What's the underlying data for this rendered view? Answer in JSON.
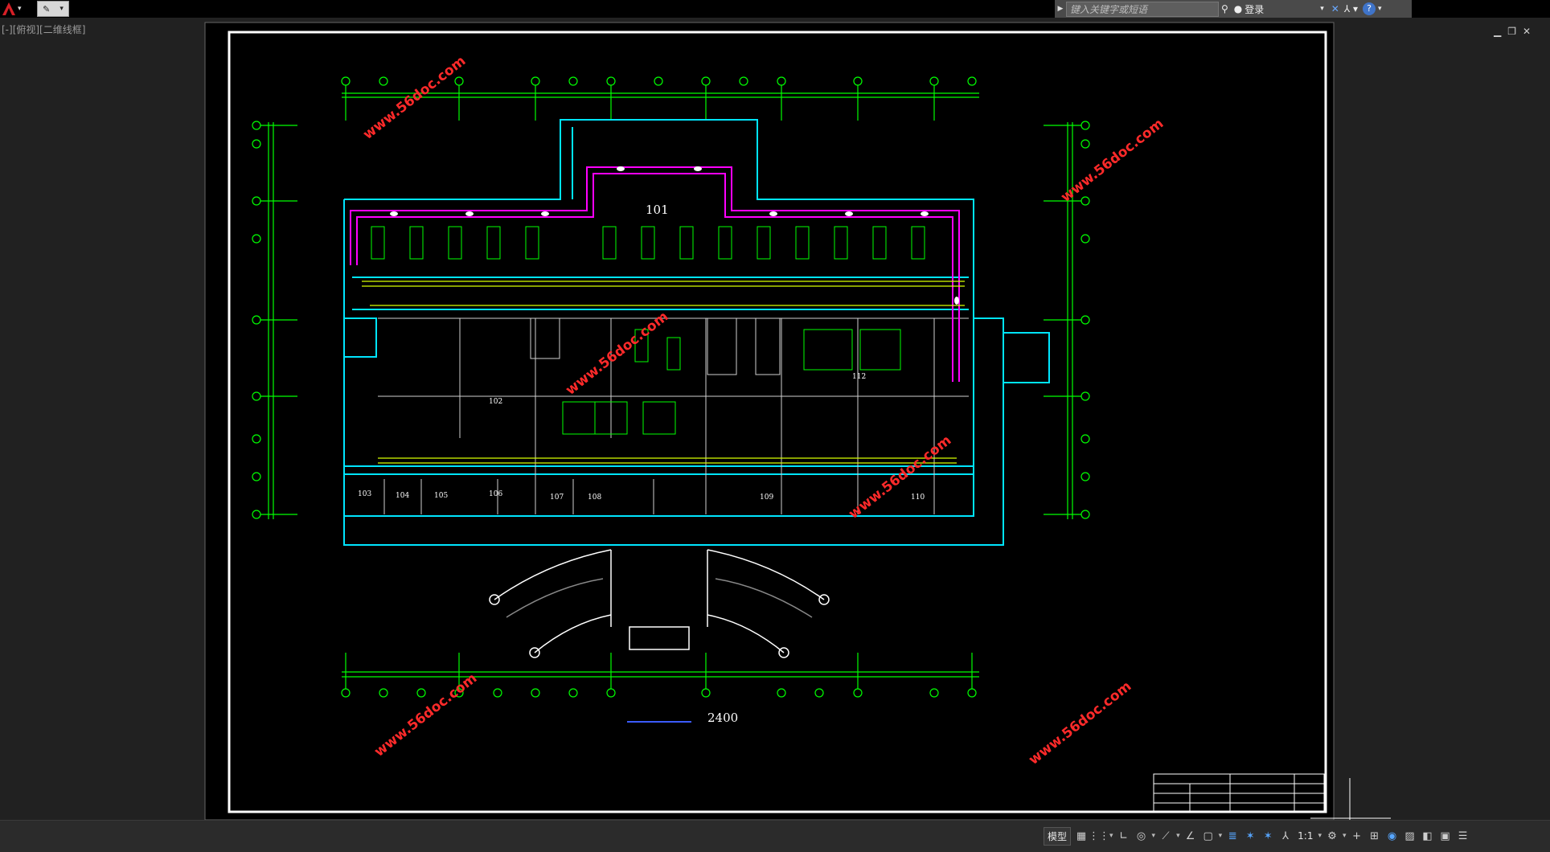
{
  "titlebar": {
    "search_placeholder": "键入关键字或短语",
    "signin_label": "登录"
  },
  "viewport": {
    "label": "[-][俯视][二维线框]"
  },
  "drawing": {
    "room_labels": [
      "101",
      "102",
      "103",
      "104",
      "105",
      "106",
      "107",
      "108",
      "109",
      "110",
      "112"
    ],
    "scale_text": "2400",
    "watermark": "www.56doc.com",
    "colors": {
      "background": "#212121",
      "sheet": "#000000",
      "grid_lines": "#00ff00",
      "walls": "#00e5ff",
      "duct_main": "#ff00ff",
      "ducts": "#ffff00",
      "outline": "#ffffff",
      "watermark": "#ff2a2a"
    }
  },
  "statusbar": {
    "model_label": "模型",
    "scale_label": "1:1"
  }
}
